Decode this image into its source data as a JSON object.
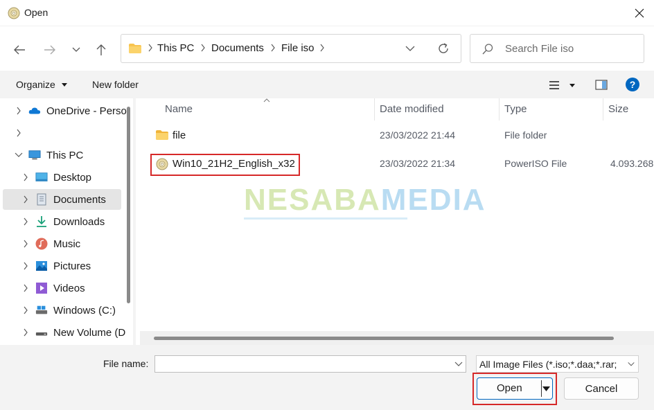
{
  "window": {
    "title": "Open",
    "close_label": "✕"
  },
  "nav": {
    "breadcrumbs": [
      "This PC",
      "Documents",
      "File iso"
    ],
    "search_placeholder": "Search File iso"
  },
  "toolbar": {
    "organize_label": "Organize",
    "new_folder_label": "New folder"
  },
  "sidebar": {
    "items": [
      {
        "label": "OneDrive - Perso",
        "icon": "onedrive-icon"
      },
      {
        "label": "",
        "icon": ""
      },
      {
        "label": "This PC",
        "icon": "this-pc-icon"
      },
      {
        "label": "Desktop",
        "icon": "desktop-icon"
      },
      {
        "label": "Documents",
        "icon": "documents-icon"
      },
      {
        "label": "Downloads",
        "icon": "downloads-icon"
      },
      {
        "label": "Music",
        "icon": "music-icon"
      },
      {
        "label": "Pictures",
        "icon": "pictures-icon"
      },
      {
        "label": "Videos",
        "icon": "videos-icon"
      },
      {
        "label": "Windows (C:)",
        "icon": "drive-icon"
      },
      {
        "label": "New Volume (D",
        "icon": "drive-icon"
      }
    ]
  },
  "columns": {
    "name": "Name",
    "date": "Date modified",
    "type": "Type",
    "size": "Size"
  },
  "files": [
    {
      "name": "file",
      "date": "23/03/2022 21:44",
      "type": "File folder",
      "size": "",
      "icon": "folder-icon"
    },
    {
      "name": "Win10_21H2_English_x32",
      "date": "23/03/2022 21:34",
      "type": "PowerISO File",
      "size": "4.093.268",
      "icon": "disc-icon"
    }
  ],
  "watermark": {
    "part1": "NESABA",
    "part2": "MEDIA"
  },
  "footer": {
    "file_name_label": "File name:",
    "file_name_value": "",
    "filter_value": "All Image Files (*.iso;*.daa;*.rar;",
    "open_label": "Open",
    "cancel_label": "Cancel"
  },
  "colors": {
    "accent": "#0067c0",
    "highlight": "#d62828",
    "folder": "#f8c44f"
  }
}
